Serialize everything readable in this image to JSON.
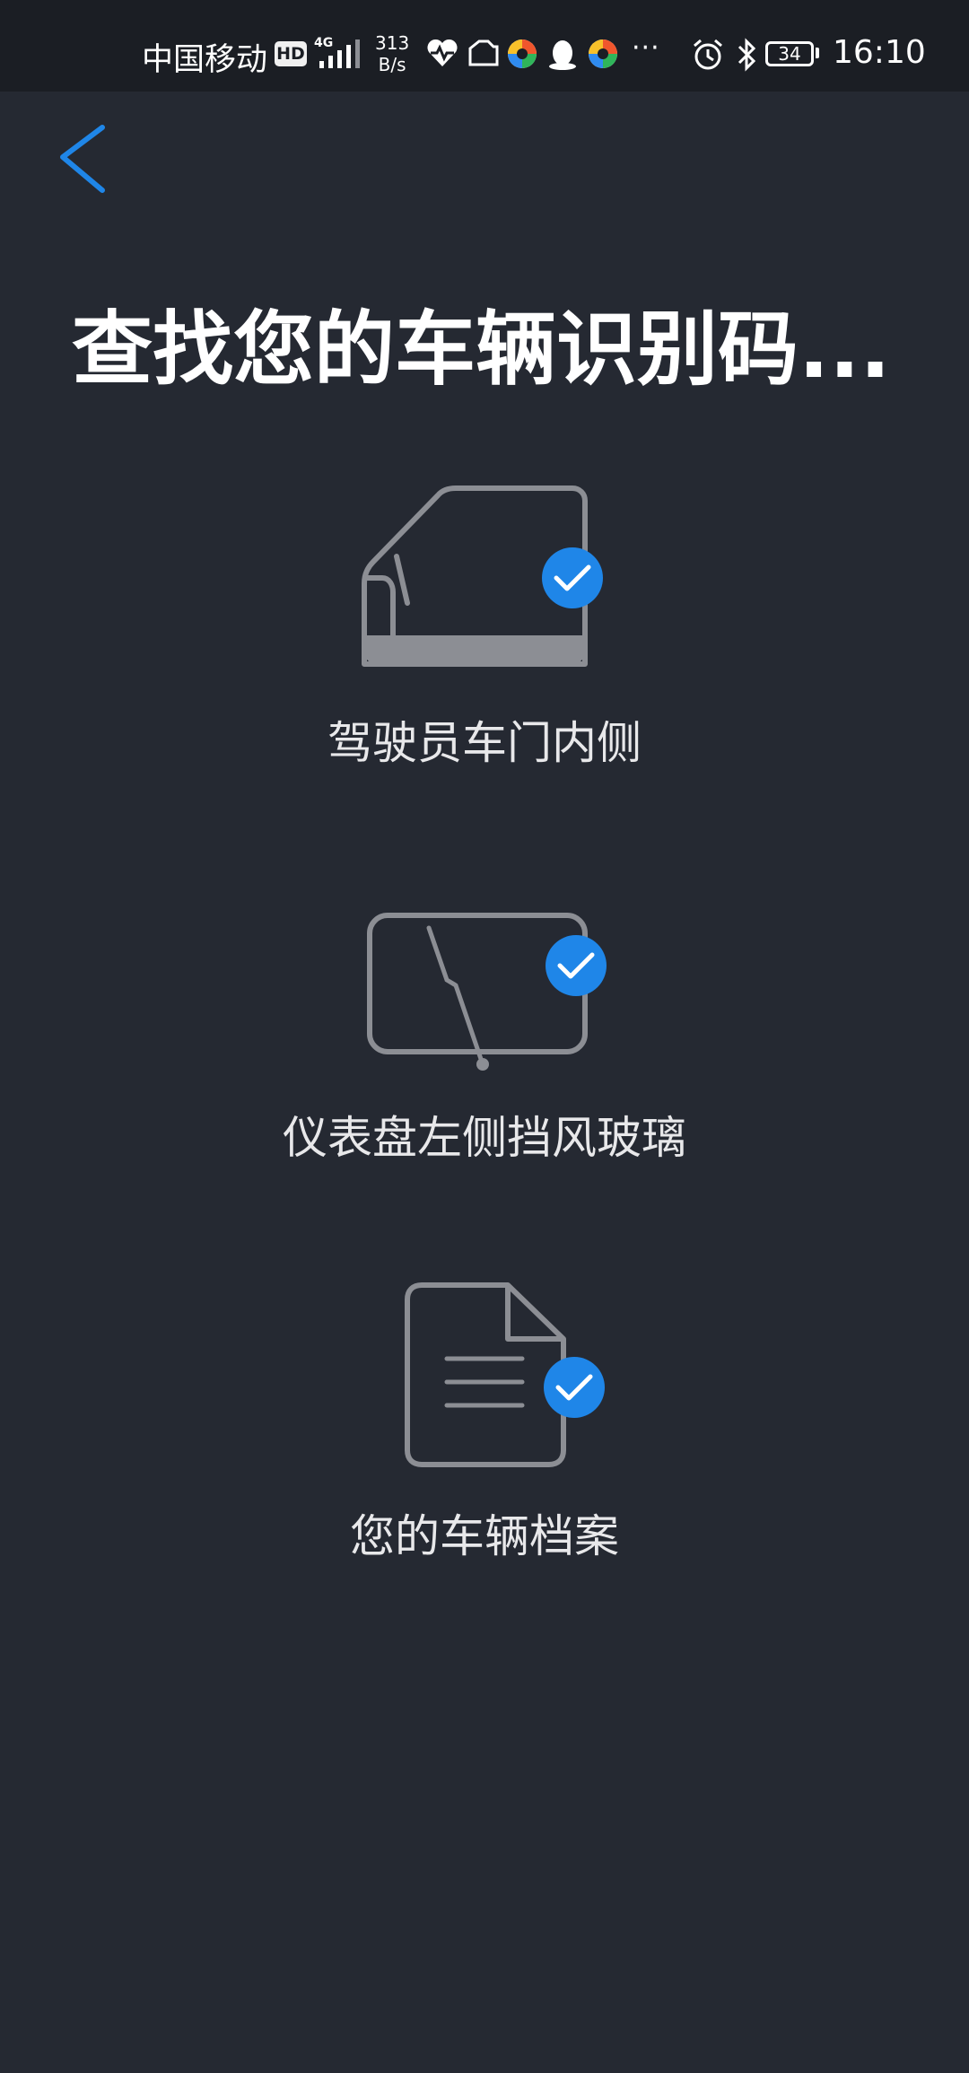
{
  "status_bar": {
    "carrier": "中国移动",
    "hd": "HD",
    "network": "4G",
    "speed_value": "313",
    "speed_unit": "B/s",
    "more": "···",
    "battery": "34",
    "time": "16:10",
    "icons": [
      "signal-icon",
      "health-icon",
      "files-icon",
      "app-icon",
      "qq-icon",
      "app-icon",
      "alarm-icon",
      "bluetooth-icon",
      "battery-icon"
    ]
  },
  "nav": {
    "back_icon": "chevron-left-icon"
  },
  "page": {
    "title": "查找您的车辆识别码..."
  },
  "options": [
    {
      "label": "驾驶员车门内侧",
      "icon": "car-door-icon",
      "checked": true
    },
    {
      "label": "仪表盘左侧挡风玻璃",
      "icon": "windshield-icon",
      "checked": true
    },
    {
      "label": "您的车辆档案",
      "icon": "document-icon",
      "checked": true
    }
  ],
  "colors": {
    "background": "#252932",
    "status_bar": "#1b1e24",
    "accent": "#1f86e8",
    "icon_stroke": "#8c8e94",
    "text": "#ffffff"
  }
}
